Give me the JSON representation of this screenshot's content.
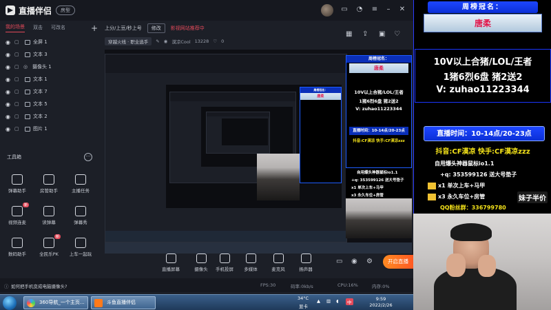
{
  "app": {
    "logo_text": "直播伴侣",
    "version_pill": "房型",
    "scene_tabs": [
      "我的场景",
      "双击",
      "可改名"
    ],
    "sources": [
      {
        "label": "全屏 1",
        "type": "box"
      },
      {
        "label": "文本 3",
        "type": "box"
      },
      {
        "label": "摄像头 1",
        "type": "cam"
      },
      {
        "label": "文本 1",
        "type": "box"
      },
      {
        "label": "文本 7",
        "type": "box"
      },
      {
        "label": "文本 5",
        "type": "box"
      },
      {
        "label": "文本 2",
        "type": "box"
      },
      {
        "label": "图片 1",
        "type": "box"
      }
    ],
    "tools_title": "工具箱",
    "tools": [
      {
        "label": "弹幕助手",
        "badge": ""
      },
      {
        "label": "房管助手",
        "badge": ""
      },
      {
        "label": "主播任务",
        "badge": ""
      },
      {
        "label": "视频连麦",
        "badge": "新"
      },
      {
        "label": "读弹幕",
        "badge": ""
      },
      {
        "label": "弹幕秀",
        "badge": ""
      },
      {
        "label": "数码助手",
        "badge": ""
      },
      {
        "label": "全民乐PK",
        "badge": "新"
      },
      {
        "label": "上车一起玩",
        "badge": ""
      }
    ]
  },
  "stream_info": {
    "title": "上分/上豆/秒上号",
    "edit_btn": "修改",
    "warning": "影视网站推荐中",
    "category": "穿越火线 · 职业选手",
    "followers": "13228",
    "host": "漠凉Cool",
    "likes": "0"
  },
  "controls": [
    {
      "label": "直播屏幕"
    },
    {
      "label": "摄像头"
    },
    {
      "label": "手机投屏"
    },
    {
      "label": "多媒体"
    },
    {
      "label": "麦克风"
    },
    {
      "label": "扬声器"
    }
  ],
  "live_button": "开启直播",
  "status_bar": {
    "help_text": "如何把手机变成电脑摄像头?",
    "fps": "FPS:30",
    "bitrate": "码率:0kb/s",
    "cpu": "CPU:16%",
    "mem": "内存:0%"
  },
  "overlay": {
    "crown": "周榜冠名：",
    "name": "唐柔",
    "line1": "10V以上合猪/LOL/王者",
    "line2": "1猪6烈6盘  猪2送2",
    "line3": "V:  zuhao11223344",
    "time": "直播时间：10-14点/20-23点",
    "douyin": "抖音:CF漠凉   快手:CF漠凉zzz",
    "tool": "自用爆头神器鼠标io1.1",
    "qq_plus": "+q:  353599126  送大号垫子",
    "x1": "x1  单次上车+马甲",
    "x3": "x3  永久车位+房管",
    "qq_fan": "QQ粉丝群：336799780",
    "sister": "妹子半价",
    "accent_blue": "#0b2fd6",
    "accent_red": "#e3164a",
    "accent_yellow": "#f7e51a"
  },
  "taskbar": {
    "start": "start-orb",
    "tasks": [
      "360导航_一个主页...",
      "斗鱼直播伴侣"
    ],
    "temp": "34°C",
    "temp_label": "显卡",
    "ime": "中",
    "time": "9:59",
    "date": "2022/2/26"
  },
  "colors": {
    "panel_bg": "#1c1f27",
    "topbar_bg": "#16181f",
    "active_red": "#e34a5a",
    "live_orange": "#ff6a22"
  }
}
